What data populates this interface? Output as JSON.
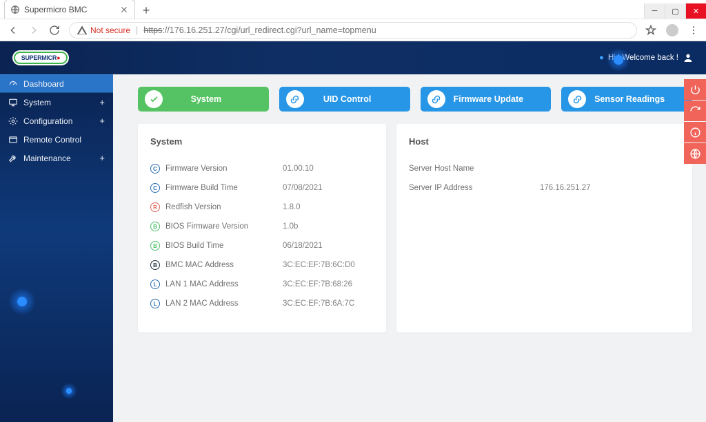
{
  "browser": {
    "tab_title": "Supermicro BMC",
    "not_secure": "Not secure",
    "url_proto": "https",
    "url_rest": "://176.16.251.27/cgi/url_redirect.cgi?url_name=topmenu"
  },
  "header": {
    "welcome": "Hi ! Welcome back !"
  },
  "sidebar": {
    "items": [
      {
        "label": "Dashboard",
        "expandable": false,
        "active": true,
        "icon": "gauge"
      },
      {
        "label": "System",
        "expandable": true,
        "active": false,
        "icon": "monitor"
      },
      {
        "label": "Configuration",
        "expandable": true,
        "active": false,
        "icon": "gear"
      },
      {
        "label": "Remote Control",
        "expandable": false,
        "active": false,
        "icon": "window"
      },
      {
        "label": "Maintenance",
        "expandable": true,
        "active": false,
        "icon": "wrench"
      }
    ]
  },
  "cards": [
    {
      "label": "System",
      "color": "green",
      "icon": "check"
    },
    {
      "label": "UID Control",
      "color": "blue",
      "icon": "link"
    },
    {
      "label": "Firmware Update",
      "color": "blue",
      "icon": "link"
    },
    {
      "label": "Sensor Readings",
      "color": "blue",
      "icon": "link"
    }
  ],
  "system_panel": {
    "title": "System",
    "rows": [
      {
        "dot": "bl",
        "glyph": "C",
        "label": "Firmware Version",
        "value": "01.00.10"
      },
      {
        "dot": "bl",
        "glyph": "C",
        "label": "Firmware Build Time",
        "value": "07/08/2021"
      },
      {
        "dot": "rd",
        "glyph": "R",
        "label": "Redfish Version",
        "value": "1.8.0"
      },
      {
        "dot": "gr",
        "glyph": "B",
        "label": "BIOS Firmware Version",
        "value": "1.0b"
      },
      {
        "dot": "gr",
        "glyph": "B",
        "label": "BIOS Build Time",
        "value": "06/18/2021"
      },
      {
        "dot": "dk",
        "glyph": "B",
        "label": "BMC MAC Address",
        "value": "3C:EC:EF:7B:6C:D0"
      },
      {
        "dot": "bl",
        "glyph": "L",
        "label": "LAN 1 MAC Address",
        "value": "3C:EC:EF:7B:68:26"
      },
      {
        "dot": "bl",
        "glyph": "L",
        "label": "LAN 2 MAC Address",
        "value": "3C:EC:EF:7B:6A:7C"
      }
    ]
  },
  "host_panel": {
    "title": "Host",
    "rows": [
      {
        "label": "Server Host Name",
        "value": ""
      },
      {
        "label": "Server IP Address",
        "value": "176.16.251.27"
      }
    ]
  }
}
